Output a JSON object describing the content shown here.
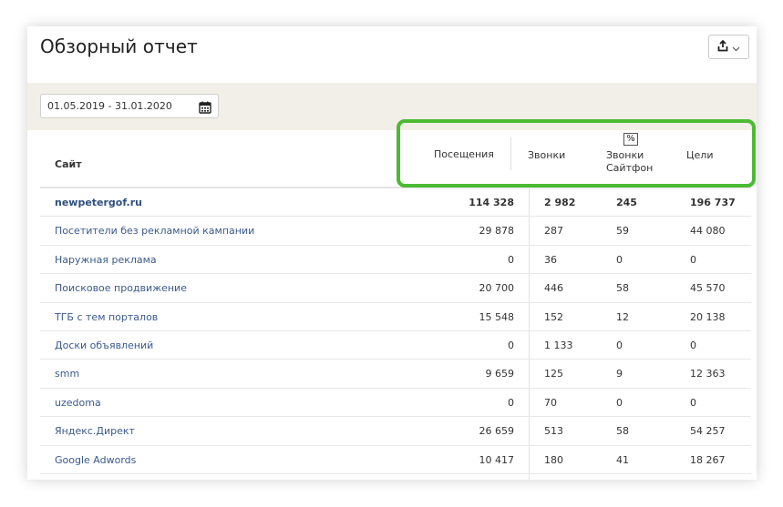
{
  "report": {
    "title": "Обзорный отчет",
    "export_icon": "share-icon",
    "dropdown_icon": "chevron-down-icon"
  },
  "filter": {
    "date_range": "01.05.2019 - 31.01.2020",
    "calendar_icon": "calendar-icon"
  },
  "table": {
    "headers": {
      "site": "Сайт",
      "visits": "Посещения",
      "calls": "Звонки",
      "sitephone_badge": "%",
      "sitephone_line1": "Звонки",
      "sitephone_line2": "Сайтфон",
      "goals": "Цели"
    },
    "rows": [
      {
        "name": "newpetergof.ru",
        "visits": "114 328",
        "calls": "2 982",
        "sitephone": "245",
        "goals": "196 737"
      },
      {
        "name": "Посетители без рекламной кампании",
        "visits": "29 878",
        "calls": "287",
        "sitephone": "59",
        "goals": "44 080"
      },
      {
        "name": "Наружная реклама",
        "visits": "0",
        "calls": "36",
        "sitephone": "0",
        "goals": "0"
      },
      {
        "name": "Поисковое продвижение",
        "visits": "20 700",
        "calls": "446",
        "sitephone": "58",
        "goals": "45 570"
      },
      {
        "name": "ТГБ с тем порталов",
        "visits": "15 548",
        "calls": "152",
        "sitephone": "12",
        "goals": "20 138"
      },
      {
        "name": "Доски объявлений",
        "visits": "0",
        "calls": "1 133",
        "sitephone": "0",
        "goals": "0"
      },
      {
        "name": "smm",
        "visits": "9 659",
        "calls": "125",
        "sitephone": "9",
        "goals": "12 363"
      },
      {
        "name": "uzedoma",
        "visits": "0",
        "calls": "70",
        "sitephone": "0",
        "goals": "0"
      },
      {
        "name": "Яндекс.Директ",
        "visits": "26 659",
        "calls": "513",
        "sitephone": "58",
        "goals": "54 257"
      },
      {
        "name": "Google Adwords",
        "visits": "10 417",
        "calls": "180",
        "sitephone": "41",
        "goals": "18 267"
      }
    ]
  },
  "colors": {
    "highlight": "#4cbb33",
    "link": "#3a5a8c",
    "filter_bar": "#f2efe8"
  }
}
